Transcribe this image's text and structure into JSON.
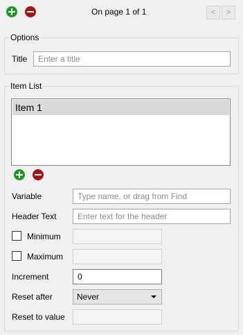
{
  "toolbar": {
    "page_status": "On page 1 of 1",
    "prev_glyph": "<",
    "next_glyph": ">"
  },
  "options": {
    "group_label": "Options",
    "title_label": "Title",
    "title_value": "",
    "title_placeholder": "Enter a title"
  },
  "item_list": {
    "group_label": "Item List",
    "items": [
      "Item 1"
    ],
    "variable_label": "Variable",
    "variable_value": "",
    "variable_placeholder": "Type name, or drag from Find",
    "header_text_label": "Header Text",
    "header_text_value": "",
    "header_text_placeholder": "Enter text for the header",
    "minimum_label": "Minimum",
    "minimum_checked": false,
    "maximum_label": "Maximum",
    "maximum_checked": false,
    "increment_label": "Increment",
    "increment_value": "0",
    "reset_after_label": "Reset after",
    "reset_after_value": "Never",
    "reset_to_value_label": "Reset to value"
  },
  "colors": {
    "add": "#1a9a25",
    "remove": "#a31414",
    "background": "#f0f0f0"
  },
  "icons": [
    "add-page-icon",
    "remove-page-icon",
    "add-item-icon",
    "remove-item-icon"
  ]
}
